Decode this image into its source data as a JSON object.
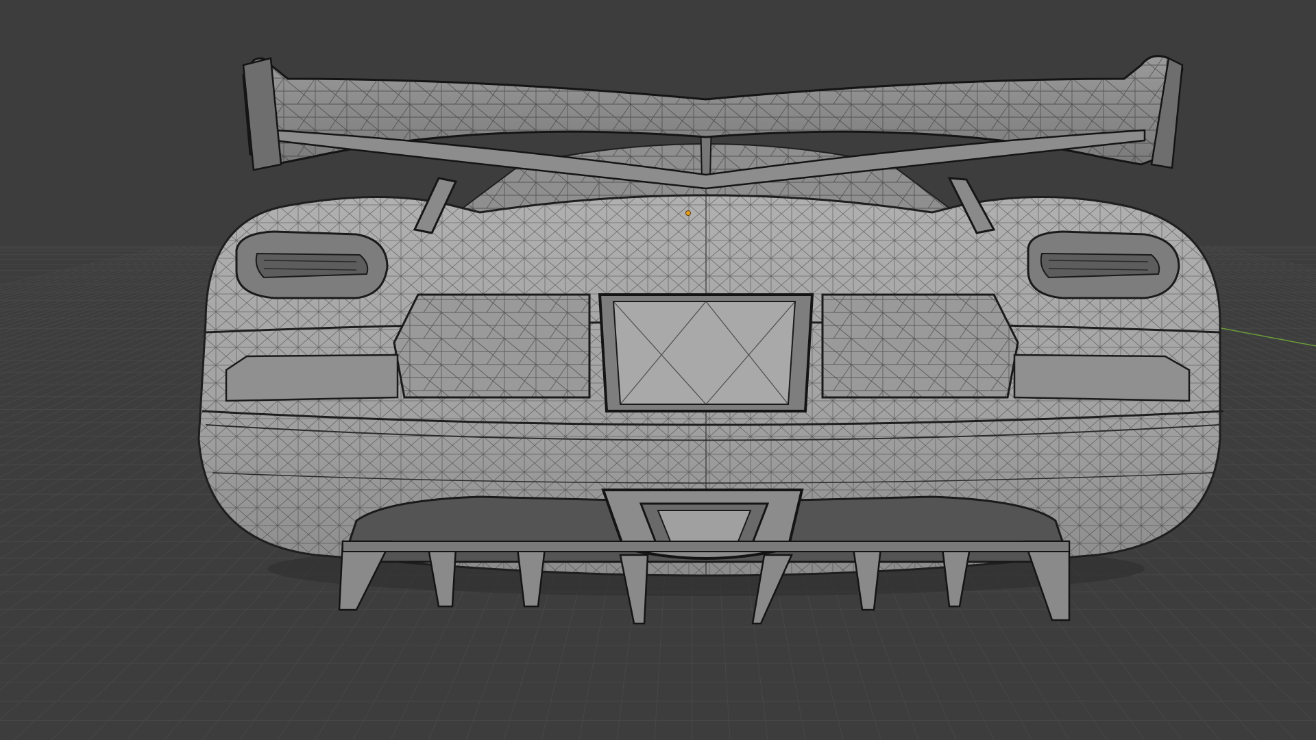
{
  "viewport": {
    "kind": "3d-viewport",
    "shading_mode": "solid-wireframe-overlay",
    "object": "car-rear-mesh"
  },
  "colors": {
    "background": "#3d3d3d",
    "grid_line": "#474747",
    "grid_line_major": "#4d4d4d",
    "mesh_face": "#a6a6a6",
    "mesh_face_light": "#b8b8b8",
    "mesh_face_dark": "#6f6f6f",
    "mesh_shadow": "#3a3a3a",
    "wire": "#1f1f1f",
    "axis_y": "#6c9e3a",
    "origin": "#e8a020"
  },
  "icons": {
    "origin_marker": "origin-dot-icon",
    "axis_line": "y-axis-line"
  }
}
